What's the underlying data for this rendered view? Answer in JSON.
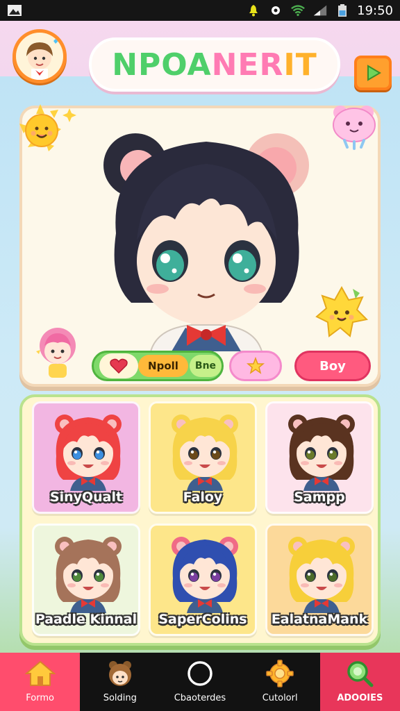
{
  "status_bar": {
    "time": "19:50"
  },
  "header": {
    "title_part1": "NPOA",
    "title_part2": "NER",
    "title_part3": "IT"
  },
  "main_card": {
    "controls": {
      "name_value": "Npoll",
      "alt_value": "Bne",
      "gender_button": "Boy"
    }
  },
  "characters": [
    {
      "name": "SinyQualt",
      "bg": "#f2b6e2",
      "hair": "#ef4343",
      "ears": "#ef4343",
      "eyes": "#3c8fe0"
    },
    {
      "name": "Faloy",
      "bg": "#fde68a",
      "hair": "#f7d34a",
      "ears": "#f7d34a",
      "eyes": "#6b4a1a"
    },
    {
      "name": "Sampp",
      "bg": "#fde3ec",
      "hair": "#5a3320",
      "ears": "#5a3320",
      "eyes": "#6a7a2a"
    },
    {
      "name": "Paadle Kinnal",
      "bg": "#eef6dd",
      "hair": "#a5735a",
      "ears": "#a5735a",
      "eyes": "#4f8a3c"
    },
    {
      "name": "SaperColins",
      "bg": "#fde68a",
      "hair": "#2f4fb0",
      "ears": "#f06b86",
      "eyes": "#7a3fa0"
    },
    {
      "name": "EalatnaMank",
      "bg": "#fcd99a",
      "hair": "#f7cf3a",
      "ears": "#f7cf3a",
      "eyes": "#4c6b2a"
    }
  ],
  "bottom_nav": [
    {
      "label": "Formo",
      "icon": "home-icon"
    },
    {
      "label": "Solding",
      "icon": "character-icon"
    },
    {
      "label": "Cbaoterdes",
      "icon": "circle-icon"
    },
    {
      "label": "Cutolorl",
      "icon": "gear-icon"
    },
    {
      "label": "ADOOIES",
      "icon": "search-icon"
    }
  ],
  "colors": {
    "accent_pink": "#ff4d6d",
    "accent_green": "#7fd96a",
    "accent_orange": "#ffa02e"
  }
}
